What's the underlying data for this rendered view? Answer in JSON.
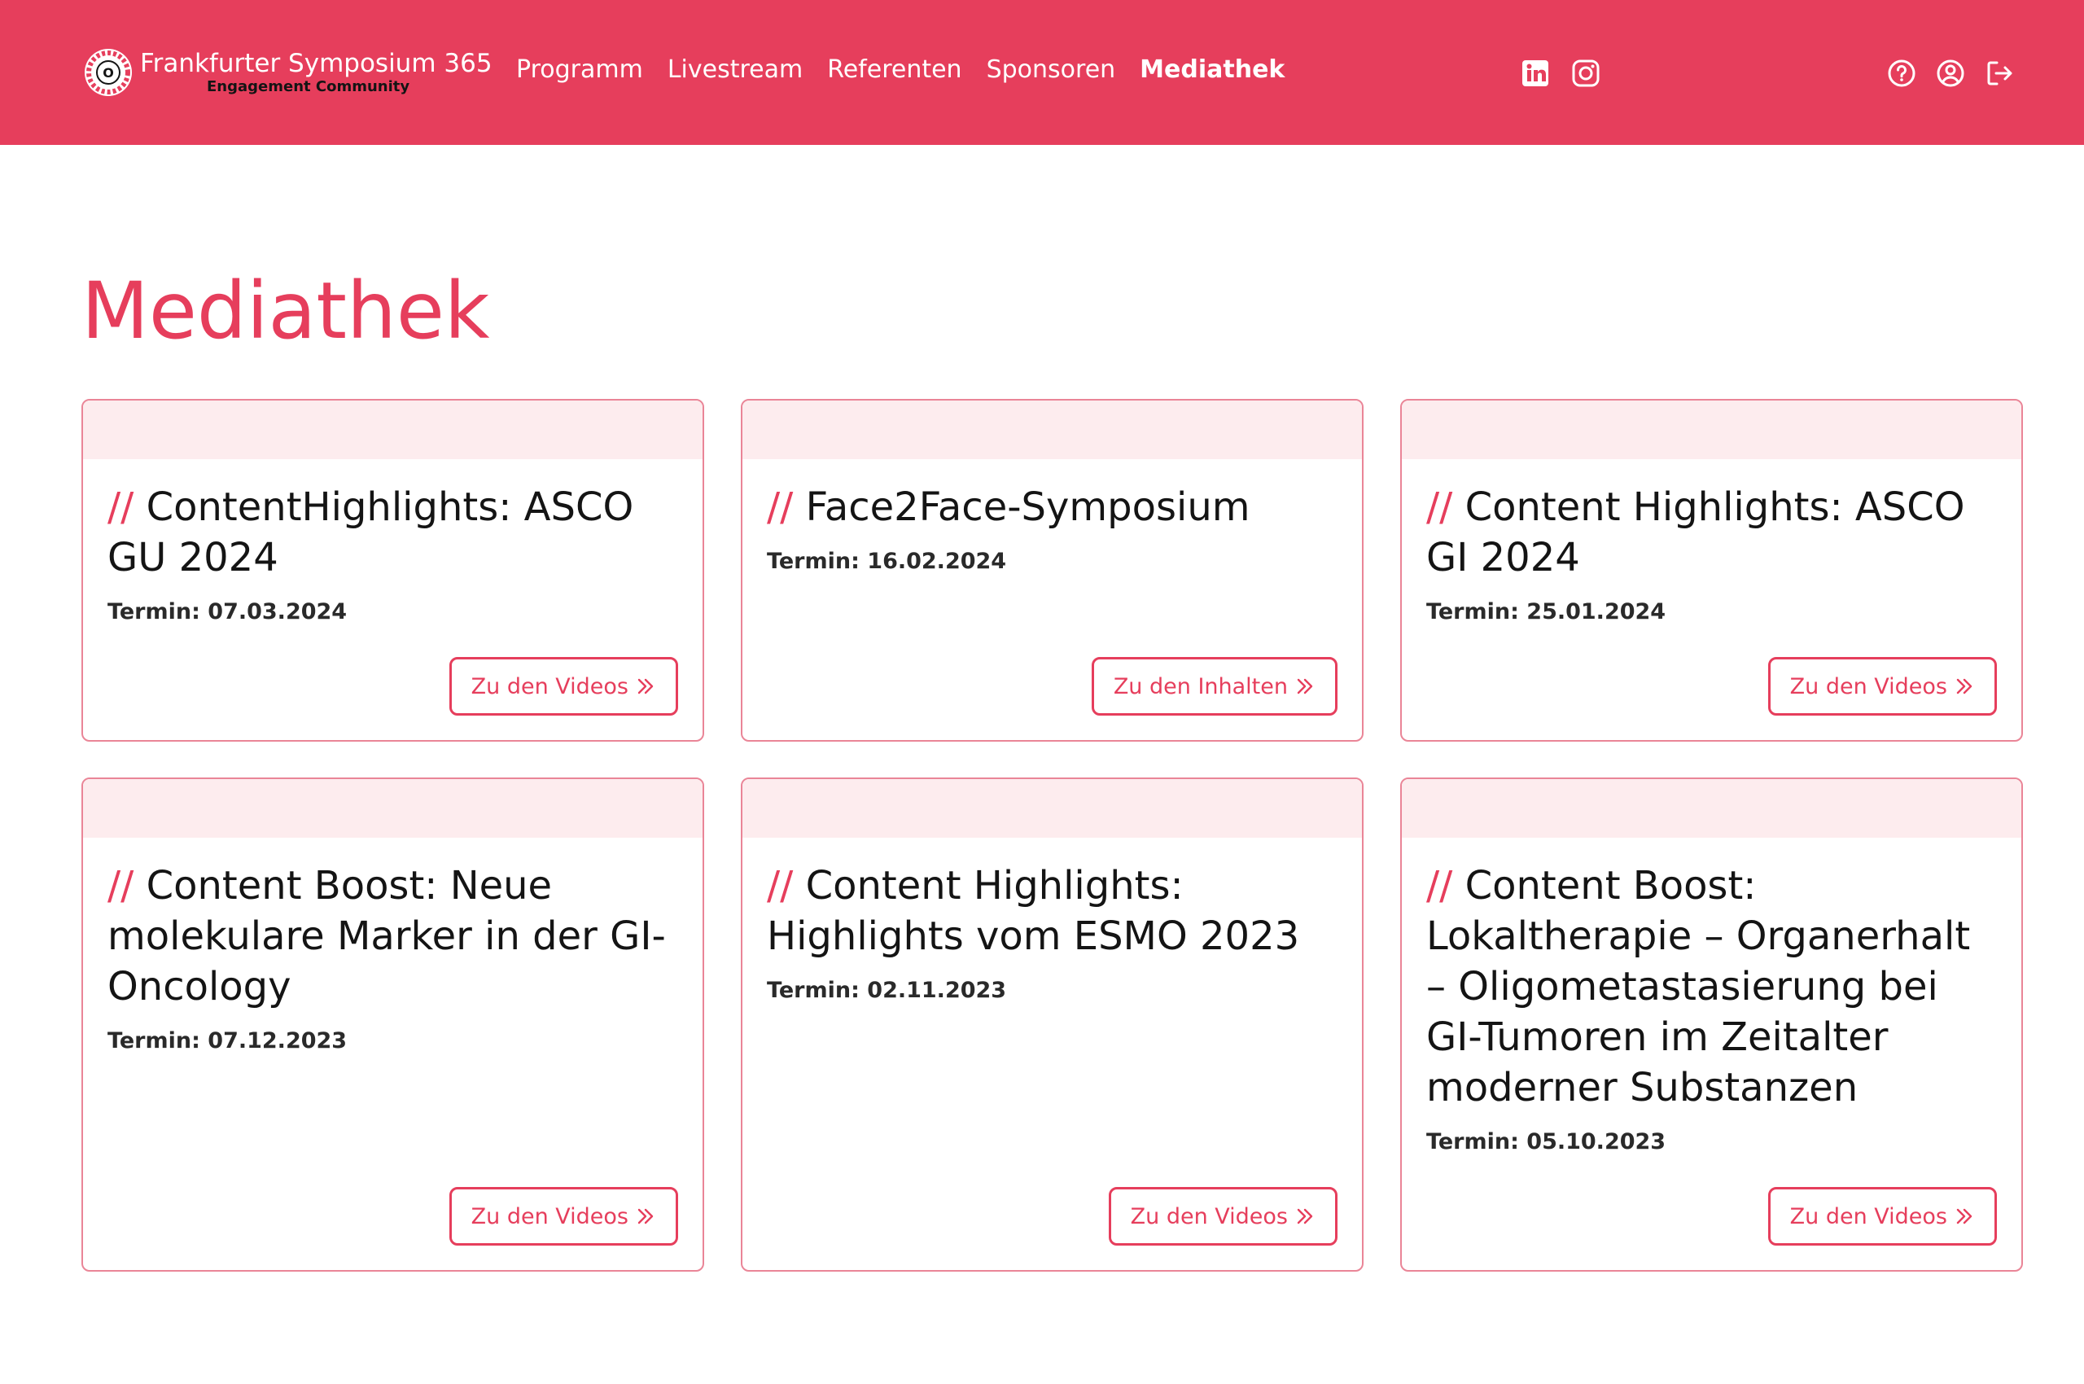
{
  "header": {
    "brand_title": "Frankfurter Symposium 365",
    "brand_subtitle": "Engagement Community",
    "nav": [
      {
        "label": "Programm",
        "active": false
      },
      {
        "label": "Livestream",
        "active": false
      },
      {
        "label": "Referenten",
        "active": false
      },
      {
        "label": "Sponsoren",
        "active": false
      },
      {
        "label": "Mediathek",
        "active": true
      }
    ],
    "social_icons": [
      "linkedin-icon",
      "instagram-icon"
    ],
    "util_icons": [
      "help-icon",
      "user-account-icon",
      "logout-icon"
    ],
    "colors": {
      "brand": "#e63e5c",
      "band": "#fdecee",
      "text": "#141414"
    }
  },
  "main": {
    "title": "Mediathek",
    "slashes": "//",
    "date_prefix": "Termin: ",
    "cards": [
      {
        "title": "ContentHighlights: ASCO GU 2024",
        "date": "07.03.2024",
        "button": "Zu den Videos"
      },
      {
        "title": "Face2Face-Symposium",
        "date": "16.02.2024",
        "button": "Zu den Inhalten"
      },
      {
        "title": "Content Highlights: ASCO GI 2024",
        "date": "25.01.2024",
        "button": "Zu den Videos"
      },
      {
        "title": "Content Boost: Neue molekulare Marker in der GI-Oncology",
        "date": "07.12.2023",
        "button": "Zu den Videos"
      },
      {
        "title": "Content Highlights: Highlights vom ESMO 2023",
        "date": "02.11.2023",
        "button": "Zu den Videos"
      },
      {
        "title": "Content Boost: Lokaltherapie – Organerhalt – Oligometastasierung bei GI-Tumoren im Zeitalter moderner Substanzen",
        "date": "05.10.2023",
        "button": "Zu den Videos"
      }
    ]
  }
}
